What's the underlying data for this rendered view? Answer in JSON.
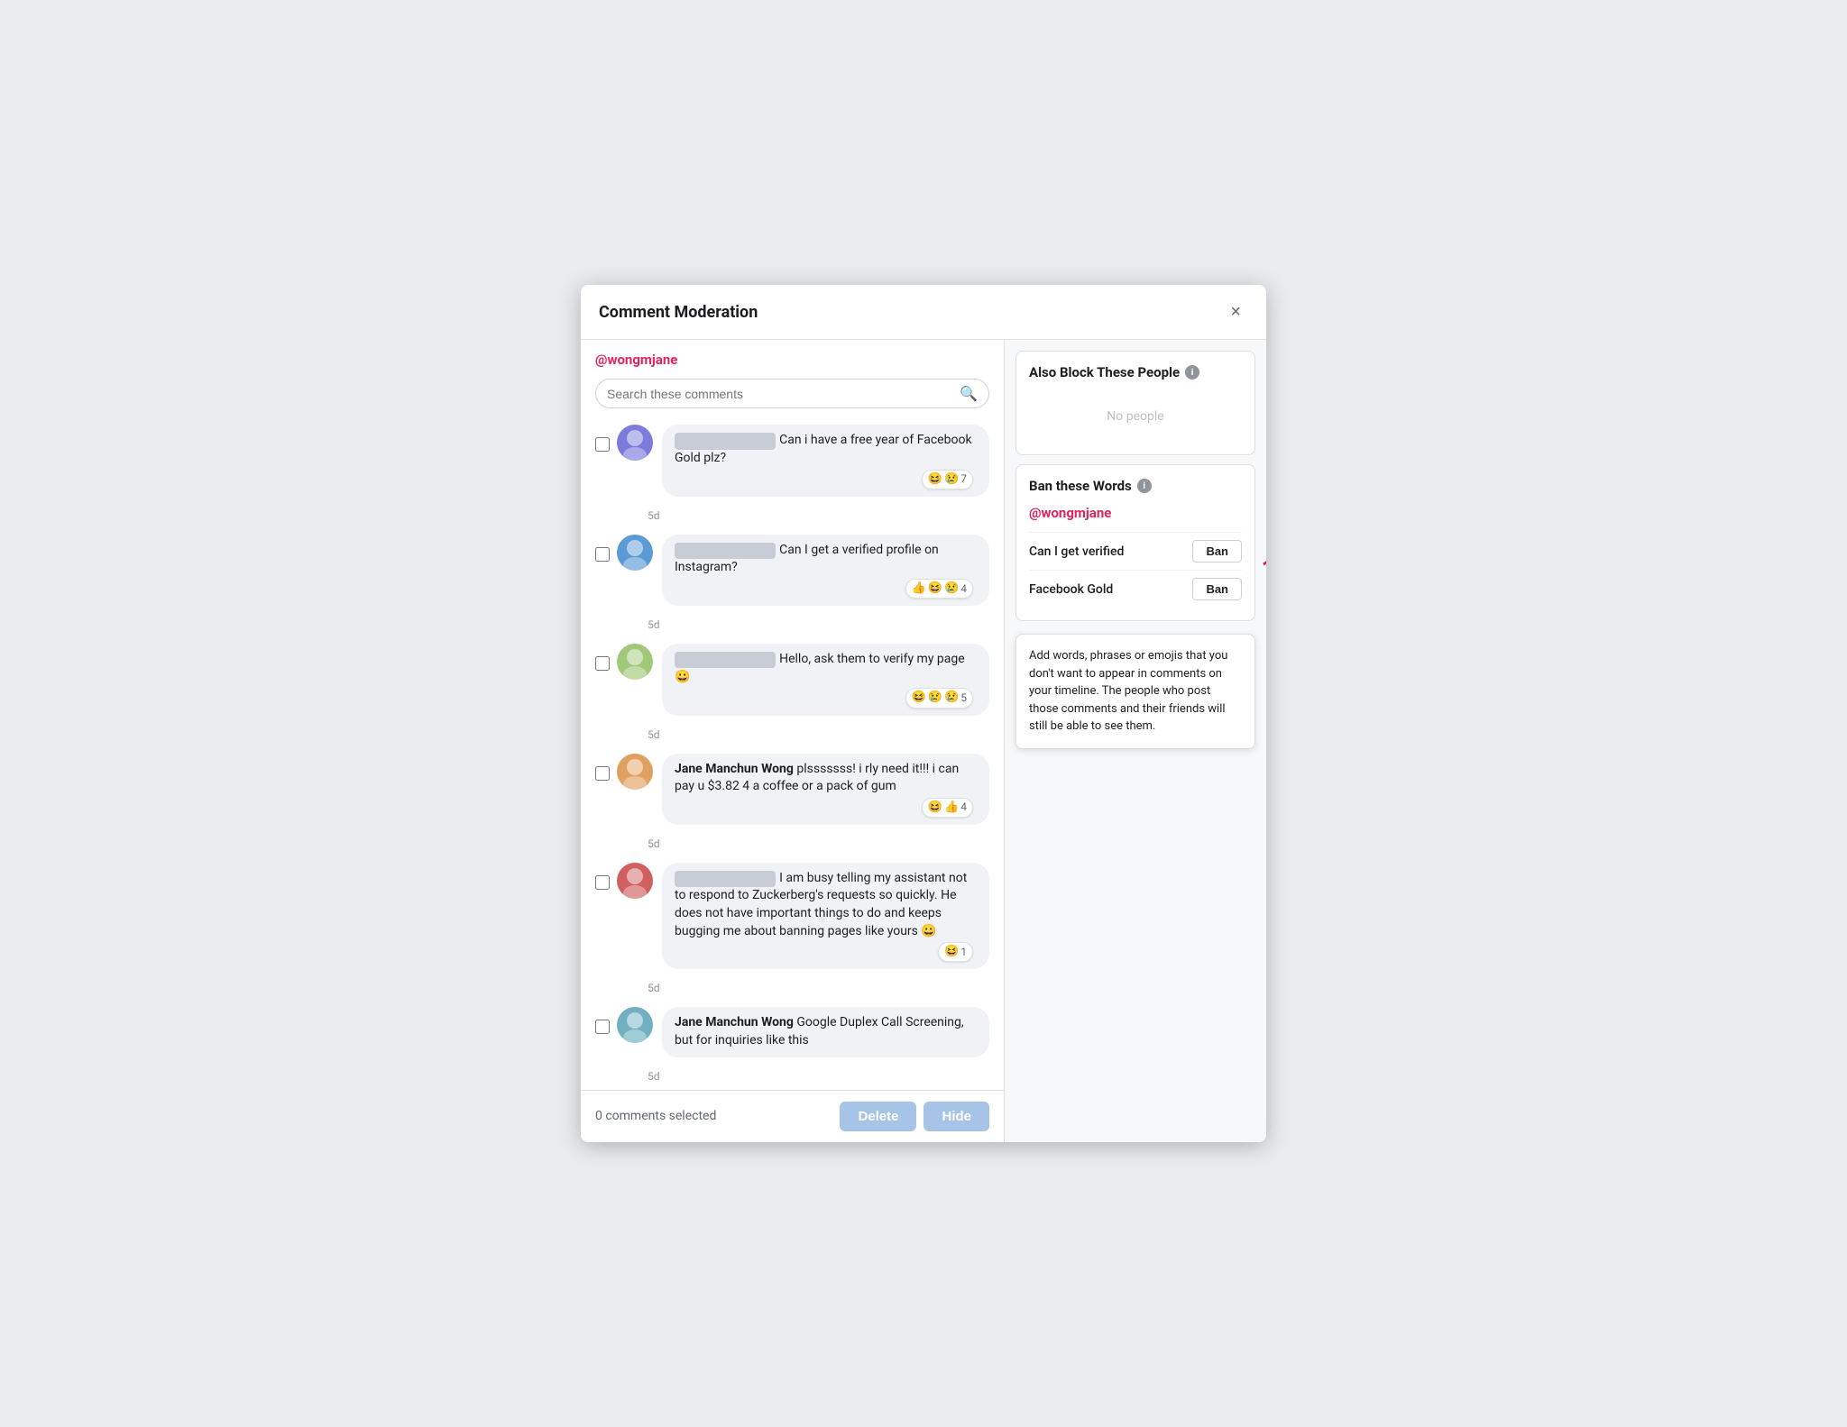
{
  "modal": {
    "title": "Comment Moderation",
    "close_label": "×"
  },
  "left_panel": {
    "username": "@wongmjane",
    "search_placeholder": "Search these comments",
    "comments": [
      {
        "id": 1,
        "author_blurred": true,
        "text": "Can i have a free year of Facebook Gold plz?",
        "reactions": [
          "😆",
          "😢"
        ],
        "reaction_count": 7,
        "timestamp": "5d"
      },
      {
        "id": 2,
        "author_blurred": true,
        "text": "Can I get a verified profile on Instagram?",
        "reactions": [
          "👍",
          "😆",
          "😢"
        ],
        "reaction_count": 4,
        "timestamp": "5d"
      },
      {
        "id": 3,
        "author_blurred": true,
        "text": "Hello, ask them to verify my page 😀",
        "reactions": [
          "😆",
          "😢",
          "😢"
        ],
        "reaction_count": 5,
        "timestamp": "5d"
      },
      {
        "id": 4,
        "author": "Jane Manchun Wong",
        "author_blurred": false,
        "text": "plsssssss! i rly need it!!! i can pay u $3.82 4 a coffee or a pack of gum",
        "reactions": [
          "😆",
          "👍"
        ],
        "reaction_count": 4,
        "timestamp": "5d"
      },
      {
        "id": 5,
        "author_blurred": true,
        "text": "I am busy telling my assistant not to respond to Zuckerberg's requests so quickly. He does not have important things to do and keeps bugging me about banning pages like yours 😀",
        "reactions": [
          "😆"
        ],
        "reaction_count": 1,
        "timestamp": "5d"
      },
      {
        "id": 6,
        "author": "Jane Manchun Wong",
        "author_blurred": false,
        "text": "Google Duplex Call Screening, but for inquiries like this",
        "reactions": [],
        "reaction_count": 0,
        "timestamp": "5d"
      }
    ],
    "footer": {
      "selected_count": "0 comments selected",
      "delete_label": "Delete",
      "hide_label": "Hide"
    }
  },
  "right_panel": {
    "also_block": {
      "title": "Also Block These People",
      "no_people_text": "No people"
    },
    "ban_words": {
      "title": "Ban these Words",
      "username": "@wongmjane",
      "words": [
        {
          "phrase": "Can I get verified",
          "ban_label": "Ban"
        },
        {
          "phrase": "Facebook Gold",
          "ban_label": "Ban"
        }
      ]
    },
    "tooltip": {
      "text": "Add words, phrases or emojis that you don't want to appear in comments on your timeline. The people who post those comments and their friends will still be able to see them."
    }
  }
}
